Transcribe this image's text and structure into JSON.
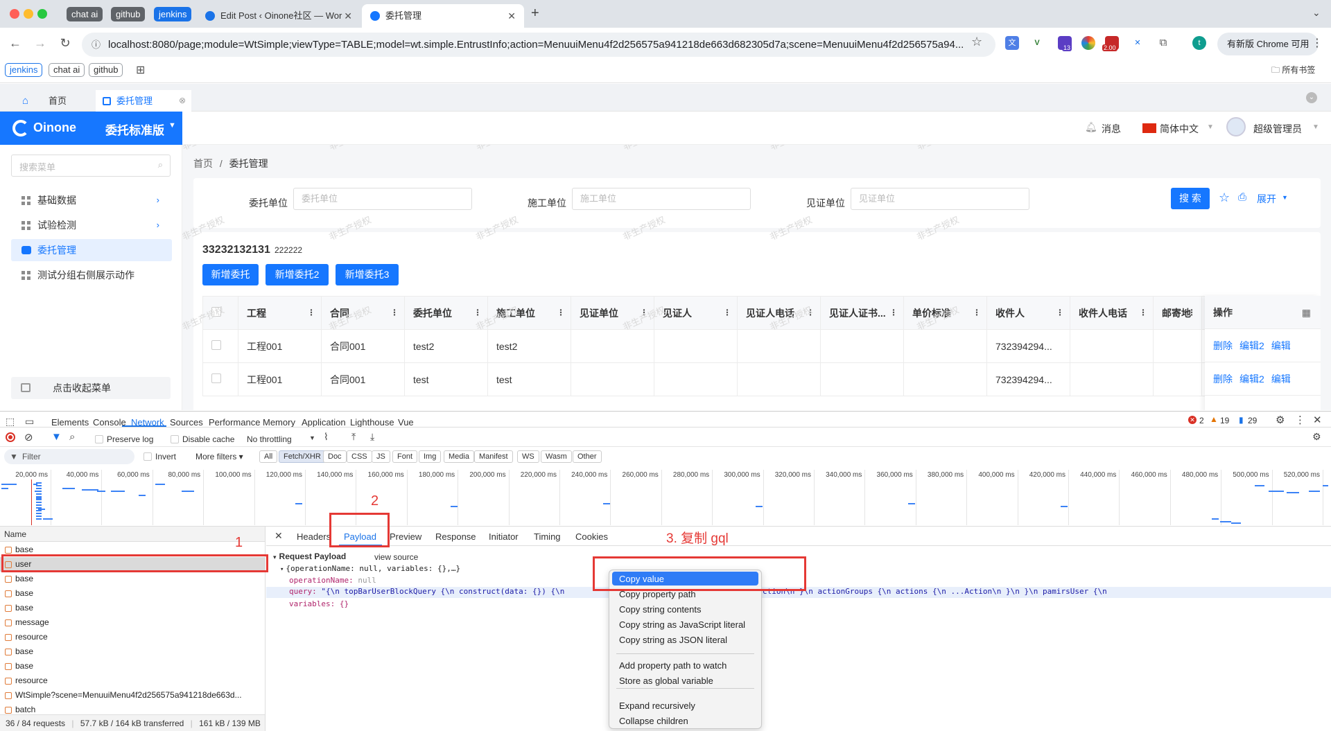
{
  "browser": {
    "pinned": [
      "chat ai",
      "github",
      "jenkins"
    ],
    "tabs": [
      {
        "title": "Edit Post ‹ Oinone社区 — Wor"
      },
      {
        "title": "委托管理"
      }
    ],
    "new_tab": "+",
    "url": "localhost:8080/page;module=WtSimple;viewType=TABLE;model=wt.simple.EntrustInfo;action=MenuuiMenu4f2d256575a941218de663d682305d7a;scene=MenuuiMenu4f2d256575a94...",
    "ext_badges": [
      "13",
      "2.00"
    ],
    "profile": "t",
    "update_button": "有新版 Chrome 可用",
    "bookmarks": [
      "jenkins",
      "chat ai",
      "github"
    ],
    "all_bookmarks": "所有书签"
  },
  "app": {
    "tabs": [
      {
        "label": "首页"
      },
      {
        "label": "委托管理"
      }
    ],
    "logo": "Oinone",
    "edition": "委托标准版",
    "header": {
      "messages": "消息",
      "language": "简体中文",
      "user": "超级管理员"
    },
    "sidebar": {
      "search_placeholder": "搜索菜单",
      "items": [
        "基础数据",
        "试验检测",
        "委托管理",
        "测试分组右侧展示动作"
      ],
      "collapse": "点击收起菜单"
    },
    "breadcrumb": [
      "首页",
      "/",
      "委托管理"
    ],
    "filters": [
      {
        "label": "委托单位",
        "placeholder": "委托单位"
      },
      {
        "label": "施工单位",
        "placeholder": "施工单位"
      },
      {
        "label": "见证单位",
        "placeholder": "见证单位"
      }
    ],
    "search_button": "搜 索",
    "expand": "展开",
    "table_title": "33232132131",
    "table_subtitle": "222222",
    "actions": [
      "新增委托",
      "新增委托2",
      "新增委托3"
    ],
    "columns": [
      "工程",
      "合同",
      "委托单位",
      "施工单位",
      "见证单位",
      "见证人",
      "见证人电话",
      "见证人证书...",
      "单价标准",
      "收件人",
      "收件人电话",
      "邮寄地"
    ],
    "op_column": "操作",
    "rows": [
      [
        "工程001",
        "合同001",
        "test2",
        "test2",
        "",
        "",
        "",
        "",
        "",
        "732394294...",
        "",
        ""
      ],
      [
        "工程001",
        "合同001",
        "test",
        "test",
        "",
        "",
        "",
        "",
        "",
        "732394294...",
        "",
        ""
      ]
    ],
    "row_ops": [
      "删除",
      "编辑2",
      "编辑"
    ],
    "watermark": "非生产授权"
  },
  "devtools": {
    "tabs": [
      "Elements",
      "Console",
      "Network",
      "Sources",
      "Performance",
      "Memory",
      "Application",
      "Lighthouse",
      "Vue"
    ],
    "errors": "2",
    "warnings": "19",
    "messages": "29",
    "preserve_log": "Preserve log",
    "disable_cache": "Disable cache",
    "throttling": "No throttling",
    "filter_placeholder": "Filter",
    "invert": "Invert",
    "more_filters": "More filters",
    "types": [
      "All",
      "Fetch/XHR",
      "Doc",
      "CSS",
      "JS",
      "Font",
      "Img",
      "Media",
      "Manifest",
      "WS",
      "Wasm",
      "Other"
    ],
    "ticks": [
      "20,000 ms",
      "40,000 ms",
      "60,000 ms",
      "80,000 ms",
      "100,000 ms",
      "120,000 ms",
      "140,000 ms",
      "160,000 ms",
      "180,000 ms",
      "200,000 ms",
      "220,000 ms",
      "240,000 ms",
      "260,000 ms",
      "280,000 ms",
      "300,000 ms",
      "320,000 ms",
      "340,000 ms",
      "360,000 ms",
      "380,000 ms",
      "400,000 ms",
      "420,000 ms",
      "440,000 ms",
      "460,000 ms",
      "480,000 ms",
      "500,000 ms",
      "520,000 ms"
    ],
    "name_header": "Name",
    "requests": [
      "base",
      "user",
      "base",
      "base",
      "base",
      "message",
      "resource",
      "base",
      "base",
      "resource",
      "WtSimple?scene=MenuuiMenu4f2d256575a941218de663d...",
      "batch"
    ],
    "status": {
      "requests": "36 / 84 requests",
      "transferred": "57.7 kB / 164 kB transferred",
      "resources": "161 kB / 139 MB"
    },
    "detail_tabs": [
      "Headers",
      "Payload",
      "Preview",
      "Response",
      "Initiator",
      "Timing",
      "Cookies"
    ],
    "payload": {
      "section": "Request Payload",
      "view_source": "view source",
      "summary": "{operationName: null, variables: {},…}",
      "op_key": "operationName:",
      "op_val": "null",
      "query_key": "query:",
      "query_val": "\"{\\n  topBarUserBlockQuery {\\n    construct(data: {}) {\\n",
      "query_tail": "ction\\n       }\\n      actionGroups {\\n         actions {\\n             ...Action\\n         }\\n        }\\n      pamirsUser {\\n",
      "vars": "variables: {}"
    },
    "context_menu": [
      "Copy value",
      "Copy property path",
      "Copy string contents",
      "Copy string as JavaScript literal",
      "Copy string as JSON literal",
      "Add property path to watch",
      "Store as global variable",
      "Expand recursively",
      "Collapse children"
    ]
  },
  "annotations": [
    "1",
    "2",
    "3. 复制 gql"
  ]
}
